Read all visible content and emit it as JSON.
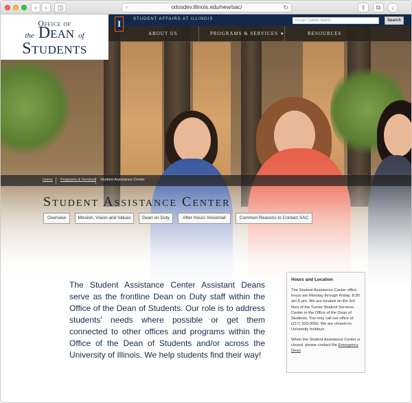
{
  "browser": {
    "url": "odosdev.illinois.edu/new/sac/"
  },
  "topbar": {
    "site_label": "STUDENT AFFAIRS AT ILLINOIS",
    "search_placeholder": "Custom Search",
    "search_brand": "Google",
    "search_button": "Search"
  },
  "logo": {
    "line1": "Office of",
    "line2_prefix": "the",
    "line2_main": "Dean",
    "line2_suffix": "of",
    "line3": "Students"
  },
  "nav": {
    "block_i": "I",
    "items": [
      "ABOUT US",
      "PROGRAMS & SERVICES",
      "RESOURCES"
    ]
  },
  "breadcrumb": {
    "items": [
      "Home",
      "Programs & Services",
      "Student Assistance Center"
    ]
  },
  "page": {
    "title": "Student Assistance Center"
  },
  "tabs": [
    "Overview",
    "Mission, Vision and Values",
    "Dean on Duty",
    "After Hours Voicemail",
    "Common Reasons to Contact SAC"
  ],
  "intro": "The Student Assistance Center Assistant Deans serve as the frontline Dean on Duty staff within the Office of the Dean of Students. Our role is to address students' needs where possible or get them connected to other offices and programs within the Office of the Dean of Students and/or across the University of Illinois. We help students find their way!",
  "sidebar": {
    "heading": "Hours and Location",
    "para1": "The Student Assistance Center office hours are Monday through Friday, 8:30 am-5 pm. We are located on the 3rd floor of the Turner Student Services Center in the Office of the Dean of Students. You may call our office at (217) 333-0050. We are closed on University holidays.",
    "para2_before": "When the Student Assistance Center is closed, please contact the ",
    "para2_link": "Emergency Dean",
    "para2_after": "."
  },
  "colors": {
    "navy": "#13294b",
    "orange": "#ff5f05"
  }
}
